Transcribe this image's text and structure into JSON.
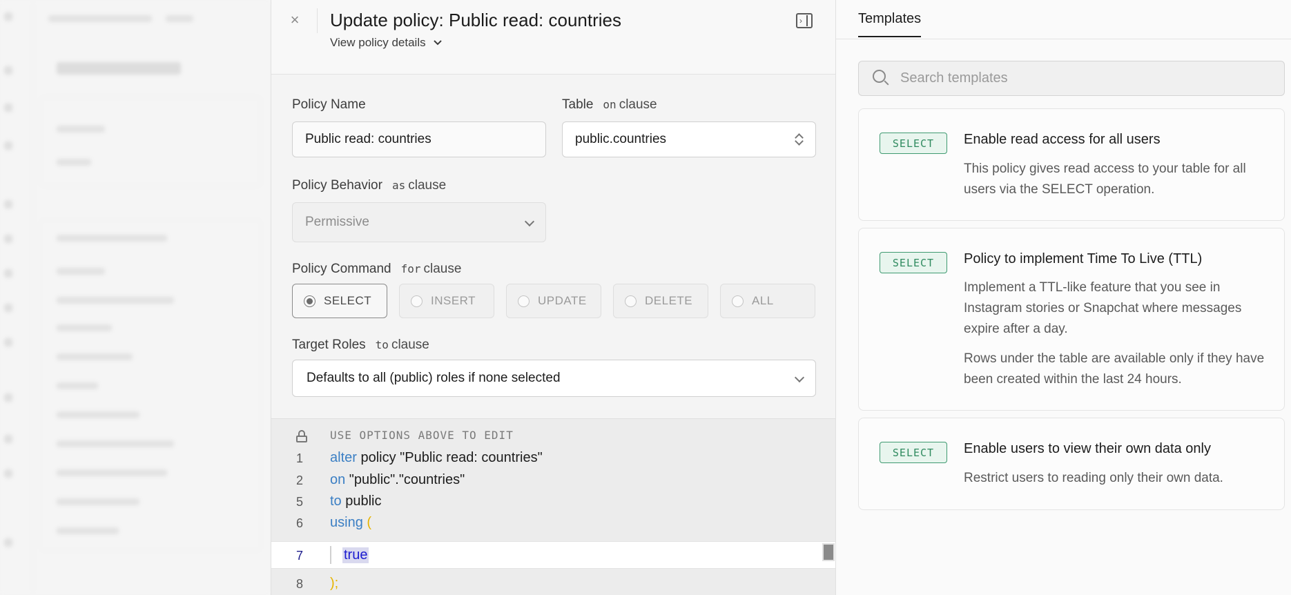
{
  "header": {
    "title": "Update policy: Public read: countries",
    "subtitle": "View policy details"
  },
  "form": {
    "policy_name_label": "Policy Name",
    "policy_name_value": "Public read: countries",
    "table_label": "Table",
    "table_clause": "on",
    "table_clause_word": "clause",
    "table_value": "public.countries",
    "behavior_label": "Policy Behavior",
    "behavior_clause": "as",
    "behavior_clause_word": "clause",
    "behavior_value": "Permissive",
    "command_label": "Policy Command",
    "command_clause": "for",
    "command_clause_word": "clause",
    "commands": [
      "SELECT",
      "INSERT",
      "UPDATE",
      "DELETE",
      "ALL"
    ],
    "selected_command": "SELECT",
    "roles_label": "Target Roles",
    "roles_clause": "to",
    "roles_clause_word": "clause",
    "roles_value": "Defaults to all (public) roles if none selected"
  },
  "code": {
    "hint": "USE OPTIONS ABOVE TO EDIT",
    "lines": [
      {
        "num": "1",
        "kw": "alter",
        "rest": " policy \"Public read: countries\""
      },
      {
        "num": "2",
        "kw": "on",
        "rest": " \"public\".\"countries\""
      },
      {
        "num": "5",
        "kw": "to",
        "rest": " public"
      },
      {
        "num": "6",
        "kw": "using",
        "rest": " ("
      },
      {
        "num": "7",
        "kw": "",
        "rest": "true"
      },
      {
        "num": "8",
        "kw": "",
        "rest": ");"
      }
    ]
  },
  "templates": {
    "tab_label": "Templates",
    "search_placeholder": "Search templates",
    "cards": [
      {
        "badge": "SELECT",
        "title": "Enable read access for all users",
        "description": "This policy gives read access to your table for all users via the SELECT operation.",
        "description2": ""
      },
      {
        "badge": "SELECT",
        "title": "Policy to implement Time To Live (TTL)",
        "description": "Implement a TTL-like feature that you see in Instagram stories or Snapchat where messages expire after a day.",
        "description2": "Rows under the table are available only if they have been created within the last 24 hours."
      },
      {
        "badge": "SELECT",
        "title": "Enable users to view their own data only",
        "description": "Restrict users to reading only their own data.",
        "description2": ""
      }
    ]
  },
  "colors": {
    "accent_green": "#3e9a70",
    "keyword_blue": "#3b7fc4",
    "paren_yellow": "#e6b400"
  }
}
